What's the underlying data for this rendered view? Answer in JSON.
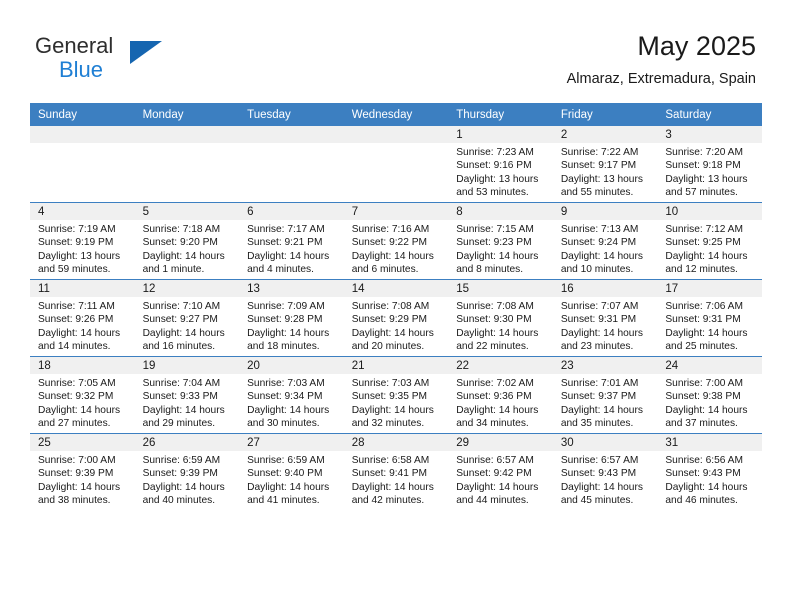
{
  "brand": {
    "name_part1": "General",
    "name_part2": "Blue",
    "logo_icon": "triangle-logo-icon",
    "accent_color": "#1f7fd4",
    "logo_color": "#1565b0"
  },
  "header": {
    "title": "May 2025",
    "location": "Almaraz, Extremadura, Spain"
  },
  "theme": {
    "header_row_color": "#3c7fc1",
    "day_band_color": "#f0f0f0",
    "cell_background": "#ffffff",
    "text_color": "#1a1a1a"
  },
  "columns": [
    "Sunday",
    "Monday",
    "Tuesday",
    "Wednesday",
    "Thursday",
    "Friday",
    "Saturday"
  ],
  "weeks": [
    [
      {
        "day": "",
        "blank": true,
        "sunrise": "",
        "sunset": "",
        "daylight_line1": "",
        "daylight_line2": ""
      },
      {
        "day": "",
        "blank": true,
        "sunrise": "",
        "sunset": "",
        "daylight_line1": "",
        "daylight_line2": ""
      },
      {
        "day": "",
        "blank": true,
        "sunrise": "",
        "sunset": "",
        "daylight_line1": "",
        "daylight_line2": ""
      },
      {
        "day": "",
        "blank": true,
        "sunrise": "",
        "sunset": "",
        "daylight_line1": "",
        "daylight_line2": ""
      },
      {
        "day": "1",
        "sunrise": "Sunrise: 7:23 AM",
        "sunset": "Sunset: 9:16 PM",
        "daylight_line1": "Daylight: 13 hours",
        "daylight_line2": "and 53 minutes."
      },
      {
        "day": "2",
        "sunrise": "Sunrise: 7:22 AM",
        "sunset": "Sunset: 9:17 PM",
        "daylight_line1": "Daylight: 13 hours",
        "daylight_line2": "and 55 minutes."
      },
      {
        "day": "3",
        "sunrise": "Sunrise: 7:20 AM",
        "sunset": "Sunset: 9:18 PM",
        "daylight_line1": "Daylight: 13 hours",
        "daylight_line2": "and 57 minutes."
      }
    ],
    [
      {
        "day": "4",
        "sunrise": "Sunrise: 7:19 AM",
        "sunset": "Sunset: 9:19 PM",
        "daylight_line1": "Daylight: 13 hours",
        "daylight_line2": "and 59 minutes."
      },
      {
        "day": "5",
        "sunrise": "Sunrise: 7:18 AM",
        "sunset": "Sunset: 9:20 PM",
        "daylight_line1": "Daylight: 14 hours",
        "daylight_line2": "and 1 minute."
      },
      {
        "day": "6",
        "sunrise": "Sunrise: 7:17 AM",
        "sunset": "Sunset: 9:21 PM",
        "daylight_line1": "Daylight: 14 hours",
        "daylight_line2": "and 4 minutes."
      },
      {
        "day": "7",
        "sunrise": "Sunrise: 7:16 AM",
        "sunset": "Sunset: 9:22 PM",
        "daylight_line1": "Daylight: 14 hours",
        "daylight_line2": "and 6 minutes."
      },
      {
        "day": "8",
        "sunrise": "Sunrise: 7:15 AM",
        "sunset": "Sunset: 9:23 PM",
        "daylight_line1": "Daylight: 14 hours",
        "daylight_line2": "and 8 minutes."
      },
      {
        "day": "9",
        "sunrise": "Sunrise: 7:13 AM",
        "sunset": "Sunset: 9:24 PM",
        "daylight_line1": "Daylight: 14 hours",
        "daylight_line2": "and 10 minutes."
      },
      {
        "day": "10",
        "sunrise": "Sunrise: 7:12 AM",
        "sunset": "Sunset: 9:25 PM",
        "daylight_line1": "Daylight: 14 hours",
        "daylight_line2": "and 12 minutes."
      }
    ],
    [
      {
        "day": "11",
        "sunrise": "Sunrise: 7:11 AM",
        "sunset": "Sunset: 9:26 PM",
        "daylight_line1": "Daylight: 14 hours",
        "daylight_line2": "and 14 minutes."
      },
      {
        "day": "12",
        "sunrise": "Sunrise: 7:10 AM",
        "sunset": "Sunset: 9:27 PM",
        "daylight_line1": "Daylight: 14 hours",
        "daylight_line2": "and 16 minutes."
      },
      {
        "day": "13",
        "sunrise": "Sunrise: 7:09 AM",
        "sunset": "Sunset: 9:28 PM",
        "daylight_line1": "Daylight: 14 hours",
        "daylight_line2": "and 18 minutes."
      },
      {
        "day": "14",
        "sunrise": "Sunrise: 7:08 AM",
        "sunset": "Sunset: 9:29 PM",
        "daylight_line1": "Daylight: 14 hours",
        "daylight_line2": "and 20 minutes."
      },
      {
        "day": "15",
        "sunrise": "Sunrise: 7:08 AM",
        "sunset": "Sunset: 9:30 PM",
        "daylight_line1": "Daylight: 14 hours",
        "daylight_line2": "and 22 minutes."
      },
      {
        "day": "16",
        "sunrise": "Sunrise: 7:07 AM",
        "sunset": "Sunset: 9:31 PM",
        "daylight_line1": "Daylight: 14 hours",
        "daylight_line2": "and 23 minutes."
      },
      {
        "day": "17",
        "sunrise": "Sunrise: 7:06 AM",
        "sunset": "Sunset: 9:31 PM",
        "daylight_line1": "Daylight: 14 hours",
        "daylight_line2": "and 25 minutes."
      }
    ],
    [
      {
        "day": "18",
        "sunrise": "Sunrise: 7:05 AM",
        "sunset": "Sunset: 9:32 PM",
        "daylight_line1": "Daylight: 14 hours",
        "daylight_line2": "and 27 minutes."
      },
      {
        "day": "19",
        "sunrise": "Sunrise: 7:04 AM",
        "sunset": "Sunset: 9:33 PM",
        "daylight_line1": "Daylight: 14 hours",
        "daylight_line2": "and 29 minutes."
      },
      {
        "day": "20",
        "sunrise": "Sunrise: 7:03 AM",
        "sunset": "Sunset: 9:34 PM",
        "daylight_line1": "Daylight: 14 hours",
        "daylight_line2": "and 30 minutes."
      },
      {
        "day": "21",
        "sunrise": "Sunrise: 7:03 AM",
        "sunset": "Sunset: 9:35 PM",
        "daylight_line1": "Daylight: 14 hours",
        "daylight_line2": "and 32 minutes."
      },
      {
        "day": "22",
        "sunrise": "Sunrise: 7:02 AM",
        "sunset": "Sunset: 9:36 PM",
        "daylight_line1": "Daylight: 14 hours",
        "daylight_line2": "and 34 minutes."
      },
      {
        "day": "23",
        "sunrise": "Sunrise: 7:01 AM",
        "sunset": "Sunset: 9:37 PM",
        "daylight_line1": "Daylight: 14 hours",
        "daylight_line2": "and 35 minutes."
      },
      {
        "day": "24",
        "sunrise": "Sunrise: 7:00 AM",
        "sunset": "Sunset: 9:38 PM",
        "daylight_line1": "Daylight: 14 hours",
        "daylight_line2": "and 37 minutes."
      }
    ],
    [
      {
        "day": "25",
        "sunrise": "Sunrise: 7:00 AM",
        "sunset": "Sunset: 9:39 PM",
        "daylight_line1": "Daylight: 14 hours",
        "daylight_line2": "and 38 minutes."
      },
      {
        "day": "26",
        "sunrise": "Sunrise: 6:59 AM",
        "sunset": "Sunset: 9:39 PM",
        "daylight_line1": "Daylight: 14 hours",
        "daylight_line2": "and 40 minutes."
      },
      {
        "day": "27",
        "sunrise": "Sunrise: 6:59 AM",
        "sunset": "Sunset: 9:40 PM",
        "daylight_line1": "Daylight: 14 hours",
        "daylight_line2": "and 41 minutes."
      },
      {
        "day": "28",
        "sunrise": "Sunrise: 6:58 AM",
        "sunset": "Sunset: 9:41 PM",
        "daylight_line1": "Daylight: 14 hours",
        "daylight_line2": "and 42 minutes."
      },
      {
        "day": "29",
        "sunrise": "Sunrise: 6:57 AM",
        "sunset": "Sunset: 9:42 PM",
        "daylight_line1": "Daylight: 14 hours",
        "daylight_line2": "and 44 minutes."
      },
      {
        "day": "30",
        "sunrise": "Sunrise: 6:57 AM",
        "sunset": "Sunset: 9:43 PM",
        "daylight_line1": "Daylight: 14 hours",
        "daylight_line2": "and 45 minutes."
      },
      {
        "day": "31",
        "sunrise": "Sunrise: 6:56 AM",
        "sunset": "Sunset: 9:43 PM",
        "daylight_line1": "Daylight: 14 hours",
        "daylight_line2": "and 46 minutes."
      }
    ]
  ]
}
